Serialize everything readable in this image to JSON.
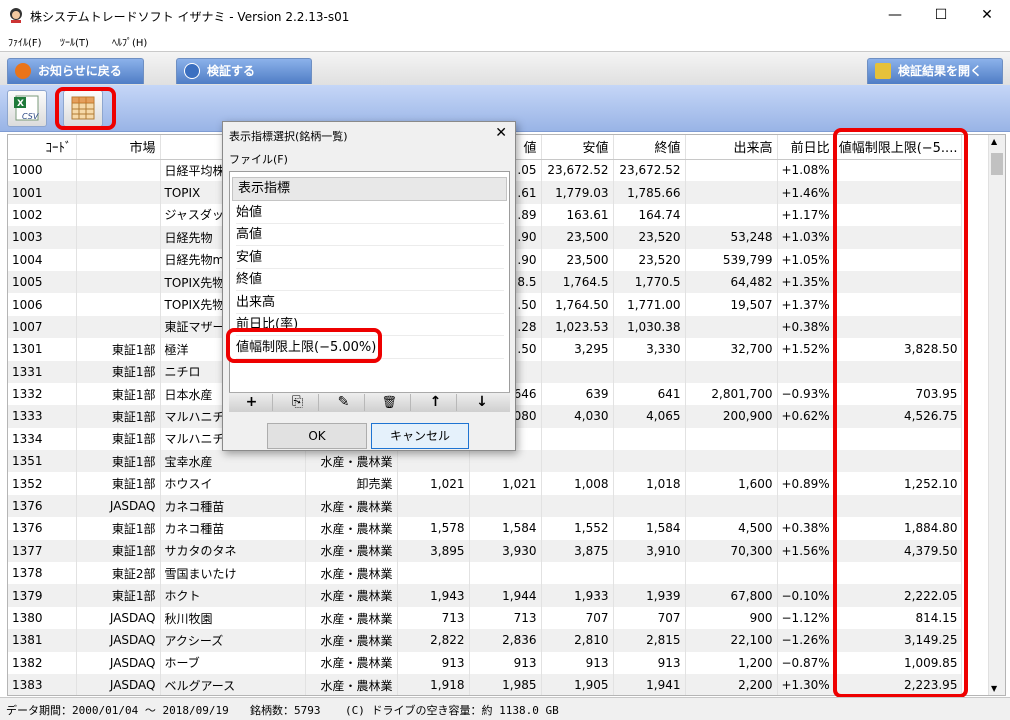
{
  "window": {
    "title": "株システムトレードソフト イザナミ - Version 2.2.13-s01",
    "min": "—",
    "max": "☐",
    "close": "✕"
  },
  "menu": [
    "ﾌｧｲﾙ(F)",
    "ﾂｰﾙ(T)",
    "ﾍﾙﾌﾟ(H)"
  ],
  "tabs": {
    "notice": "お知らせに戻る",
    "verify": "検証する",
    "open_results": "検証結果を開く"
  },
  "toolbar": {
    "csv_label": "CSV"
  },
  "grid": {
    "columns": [
      "ｺｰﾄﾞ",
      "市場",
      "銘柄",
      "",
      "",
      "値",
      "安値",
      "終値",
      "出来高",
      "前日比",
      "値幅制限上限(−5...."
    ],
    "rows": [
      [
        "1000",
        "",
        "日経平均株",
        "",
        "",
        ".05",
        "23,672.52",
        "23,672.52",
        "",
        "+1.08%",
        ""
      ],
      [
        "1001",
        "",
        "TOPIX",
        "",
        "",
        ".61",
        "1,779.03",
        "1,785.66",
        "",
        "+1.46%",
        ""
      ],
      [
        "1002",
        "",
        "ジャスダック",
        "",
        "",
        ".89",
        "163.61",
        "164.74",
        "",
        "+1.17%",
        ""
      ],
      [
        "1003",
        "",
        "日経先物",
        "",
        "",
        ".90",
        "23,500",
        "23,520",
        "53,248",
        "+1.03%",
        ""
      ],
      [
        "1004",
        "",
        "日経先物m",
        "",
        "",
        ".90",
        "23,500",
        "23,520",
        "539,799",
        "+1.05%",
        ""
      ],
      [
        "1005",
        "",
        "TOPIX先物",
        "",
        "",
        "8.5",
        "1,764.5",
        "1,770.5",
        "64,482",
        "+1.35%",
        ""
      ],
      [
        "1006",
        "",
        "TOPIX先物",
        "",
        "",
        ".50",
        "1,764.50",
        "1,771.00",
        "19,507",
        "+1.37%",
        ""
      ],
      [
        "1007",
        "",
        "東証マザー",
        "",
        "",
        ".28",
        "1,023.53",
        "1,030.38",
        "",
        "+0.38%",
        ""
      ],
      [
        "1301",
        "東証1部",
        "極洋",
        "",
        "",
        ".50",
        "3,295",
        "3,330",
        "32,700",
        "+1.52%",
        "3,828.50"
      ],
      [
        "1331",
        "東証1部",
        "ニチロ",
        "",
        "",
        "",
        "",
        "",
        "",
        "",
        ""
      ],
      [
        "1332",
        "東証1部",
        "日本水産",
        "",
        "",
        "646",
        "639",
        "641",
        "2,801,700",
        "−0.93%",
        "703.95"
      ],
      [
        "1333",
        "東証1部",
        "マルハニチロ",
        "",
        "",
        "080",
        "4,030",
        "4,065",
        "200,900",
        "+0.62%",
        "4,526.75"
      ],
      [
        "1334",
        "東証1部",
        "マルハニチロ",
        "",
        "",
        "",
        "",
        "",
        "",
        "",
        ""
      ],
      [
        "1351",
        "東証1部",
        "宝幸水産",
        "水産・農林業",
        "",
        "",
        "",
        "",
        "",
        "",
        ""
      ],
      [
        "1352",
        "東証1部",
        "ホウスイ",
        "卸売業",
        "1,021",
        "1,021",
        "1,008",
        "1,018",
        "1,600",
        "+0.89%",
        "1,252.10"
      ],
      [
        "1376",
        "JASDAQ",
        "カネコ種苗",
        "水産・農林業",
        "",
        "",
        "",
        "",
        "",
        "",
        ""
      ],
      [
        "1376",
        "東証1部",
        "カネコ種苗",
        "水産・農林業",
        "1,578",
        "1,584",
        "1,552",
        "1,584",
        "4,500",
        "+0.38%",
        "1,884.80"
      ],
      [
        "1377",
        "東証1部",
        "サカタのタネ",
        "水産・農林業",
        "3,895",
        "3,930",
        "3,875",
        "3,910",
        "70,300",
        "+1.56%",
        "4,379.50"
      ],
      [
        "1378",
        "東証2部",
        "雪国まいたけ",
        "水産・農林業",
        "",
        "",
        "",
        "",
        "",
        "",
        ""
      ],
      [
        "1379",
        "東証1部",
        "ホクト",
        "水産・農林業",
        "1,943",
        "1,944",
        "1,933",
        "1,939",
        "67,800",
        "−0.10%",
        "2,222.05"
      ],
      [
        "1380",
        "JASDAQ",
        "秋川牧園",
        "水産・農林業",
        "713",
        "713",
        "707",
        "707",
        "900",
        "−1.12%",
        "814.15"
      ],
      [
        "1381",
        "JASDAQ",
        "アクシーズ",
        "水産・農林業",
        "2,822",
        "2,836",
        "2,810",
        "2,815",
        "22,100",
        "−1.26%",
        "3,149.25"
      ],
      [
        "1382",
        "JASDAQ",
        "ホーブ",
        "水産・農林業",
        "913",
        "913",
        "913",
        "913",
        "1,200",
        "−0.87%",
        "1,009.85"
      ],
      [
        "1383",
        "JASDAQ",
        "ベルグアース",
        "水産・農林業",
        "1,918",
        "1,985",
        "1,905",
        "1,941",
        "2,200",
        "+1.30%",
        "2,223.95"
      ]
    ]
  },
  "status": {
    "period": "データ期間：2000/01/04 〜 2018/09/19",
    "count": "銘柄数：5793",
    "disk": "(C) ドライブの空き容量：約 1138.0 GB"
  },
  "dialog": {
    "title": "表示指標選択(銘柄一覧)",
    "menu": "ファイル(F)",
    "list_header": "表示指標",
    "items": [
      "始値",
      "高値",
      "安値",
      "終値",
      "出来高",
      "前日比(率)",
      "値幅制限上限(−5.00%)"
    ],
    "tools": [
      "+",
      "⎘",
      "✎",
      "🗑",
      "↑",
      "↓"
    ],
    "ok": "OK",
    "cancel": "キャンセル"
  },
  "colors": {
    "highlight": "#ee0000",
    "tab": "#4f7dc5",
    "toolbar": "#99b4e6"
  }
}
